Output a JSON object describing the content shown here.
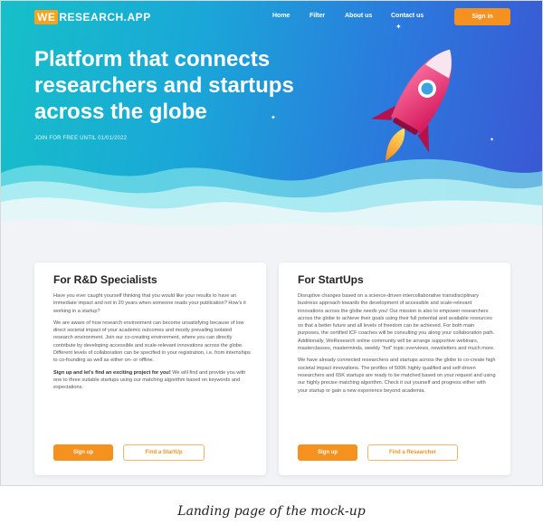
{
  "header": {
    "logo_we": "WE",
    "logo_rest": "RESEARCH.APP",
    "nav": [
      "Home",
      "Filter",
      "About us",
      "Contact us"
    ],
    "signin_label": "Sign in"
  },
  "hero": {
    "headline_line1": "Platform that connects",
    "headline_line2": "researchers and startups",
    "headline_line3": "across the globe",
    "subline": "JOIN FOR FREE UNTIL 01/01/2022"
  },
  "cards": [
    {
      "title": "For R&D Specialists",
      "paragraphs": [
        "Have you ever caught yourself thinking that you would like your results to have an immediate impact and not in 20 years when someone reads your publication? How's it working in a startup?",
        "We are aware of how research environment can become unsatisfying because of low direct societal impact of your academic outcomes and mostly prevailing isolated research environment. Join our co-creating environment, where you can directly contribute by developing accessible and scale-relevant innovations across the globe. Different levels of collaboration can be specified in your registration, i.e. from internships to co-founding as well as either on- or offline."
      ],
      "cta_bold": "Sign up and let's find an exciting project for you!",
      "cta_rest": " We will find and provide you with one to three suitable startups using our matching algorithm based on keywords and expectations.",
      "primary_label": "Sign up",
      "secondary_label": "Find a StartUp"
    },
    {
      "title": "For StartUps",
      "paragraphs": [
        "Disruptive changes based on a science-driven intercollaborative transdisciplinary business approach towards the development of accessible and scale-relevant innovations across the globe needs you! Our mission is also to empower researchers across the globe to achieve their goals using their full potential and available resources so that a better future and all levels of freedom can be achieved. For both main purposes, the certified ICF coaches will be consulting you along your collaboration path. Additionally, WeResearch online community will be arrange supportive webinars, masterclasses, masterminds, weekly \"hot\" topic overviews, newsletters and much more.",
        "We have already connected researchers and startups across the globe to co-create high societal impact innovations. The profiles of 500K highly qualified and self-driven researchers and 65K startups are ready to be matched based on your request and using our highly precise matching algorithm. Check it out yourself and progress either with your startup or gain a new experience beyond academia."
      ],
      "primary_label": "Sign up",
      "secondary_label": "Find a Researcher"
    }
  ],
  "caption": "Landing page of the mock-up",
  "colors": {
    "accent": "#f5911f",
    "hero_start": "#16c0c8",
    "hero_end": "#3c56d4"
  }
}
